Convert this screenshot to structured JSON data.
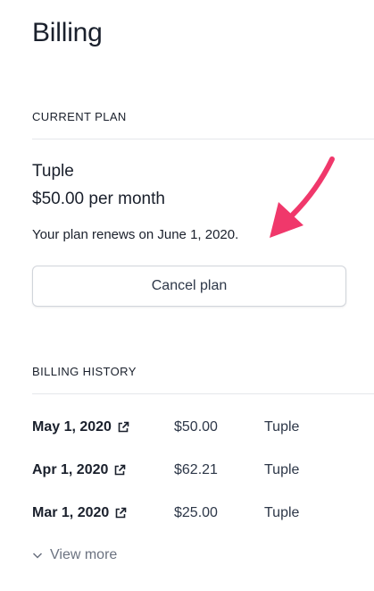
{
  "page": {
    "title": "Billing"
  },
  "current_plan": {
    "heading": "CURRENT PLAN",
    "plan_name": "Tuple",
    "price": "$50.00 per month",
    "renewal_text": "Your plan renews on June 1, 2020.",
    "cancel_label": "Cancel plan"
  },
  "billing_history": {
    "heading": "BILLING HISTORY",
    "rows": [
      {
        "date": "May 1, 2020",
        "amount": "$50.00",
        "plan": "Tuple"
      },
      {
        "date": "Apr 1, 2020",
        "amount": "$62.21",
        "plan": "Tuple"
      },
      {
        "date": "Mar 1, 2020",
        "amount": "$25.00",
        "plan": "Tuple"
      }
    ],
    "view_more_label": "View more"
  },
  "icons": {
    "external_link": "external-link-icon",
    "chevron_down": "chevron-down-icon",
    "annotation_arrow": "annotation-arrow"
  },
  "colors": {
    "annotation_arrow": "#f0386b",
    "divider": "#e5e7eb",
    "muted_text": "#6b7280"
  }
}
